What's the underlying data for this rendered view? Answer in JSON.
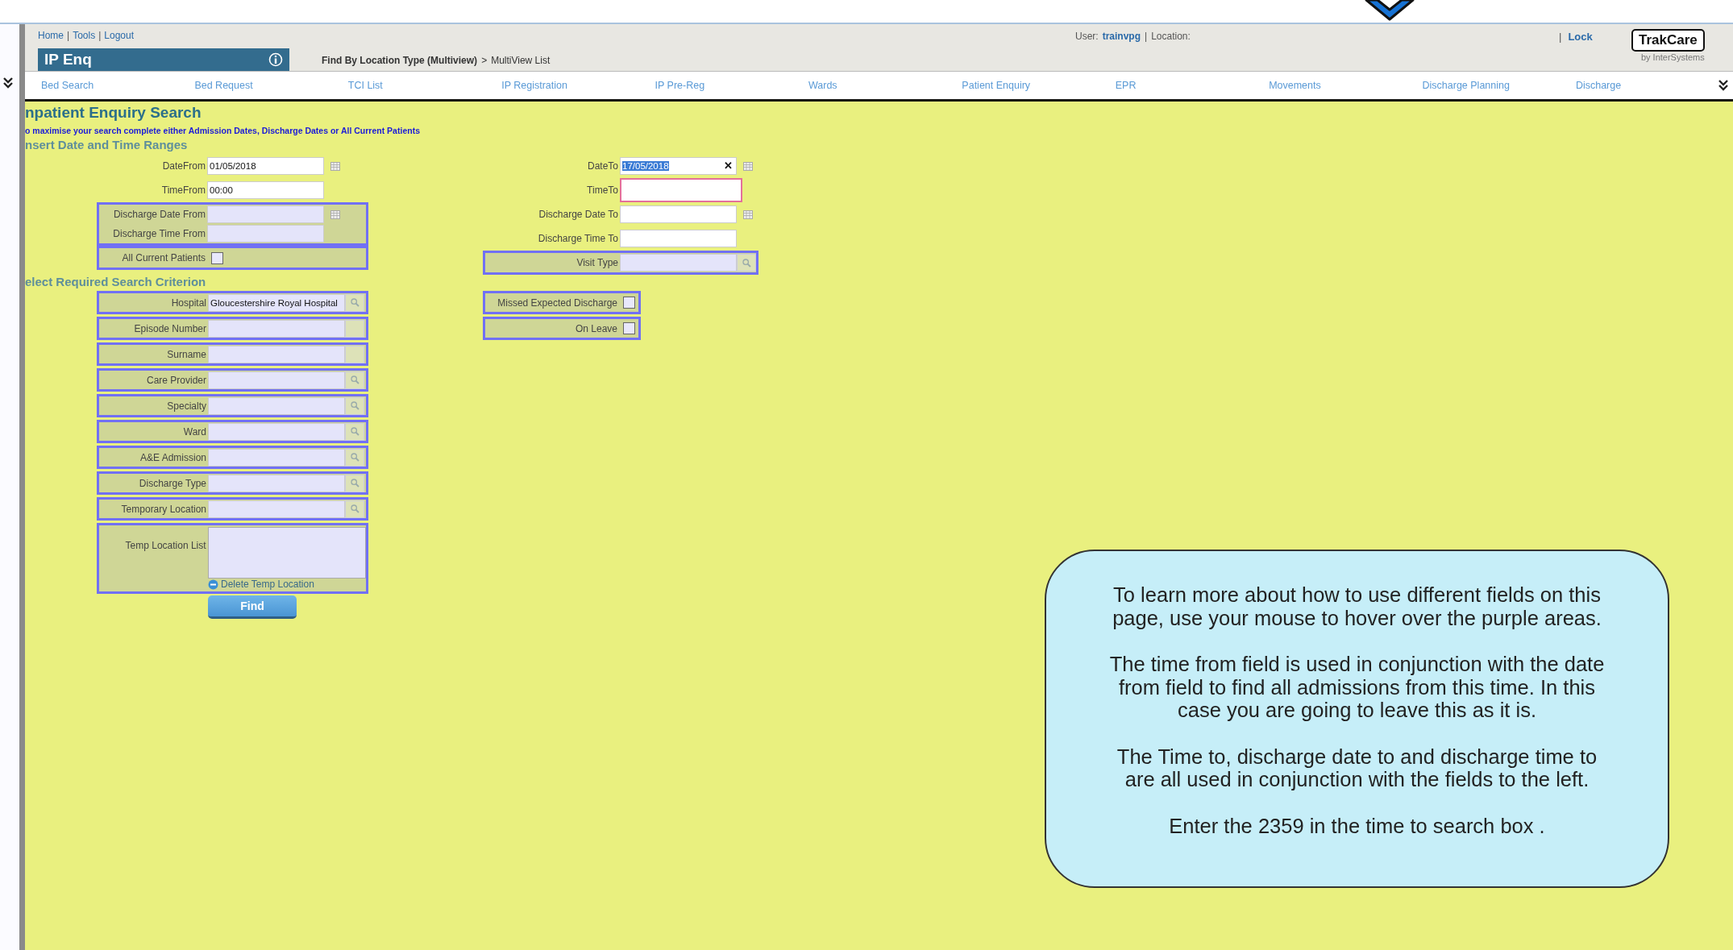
{
  "header": {
    "links": [
      "Home",
      "Tools",
      "Logout"
    ],
    "link_separator": "|",
    "title": "IP Enq",
    "breadcrumb": [
      "Find By Location Type (Multiview)",
      "MultiView List"
    ],
    "breadcrumb_separator": ">",
    "user_label": "User:",
    "user": "trainvpg",
    "info_separator": "|",
    "location_label": "Location:",
    "lock_separator": "|",
    "lock": "Lock",
    "logo": "TrakCare",
    "logo_sub": "by InterSystems"
  },
  "nav": {
    "items": [
      "Bed Search",
      "Bed Request",
      "TCI List",
      "IP Registration",
      "IP Pre-Reg",
      "Wards",
      "Patient Enquiry",
      "EPR",
      "Movements",
      "Discharge Planning",
      "Discharge"
    ]
  },
  "page": {
    "title": "npatient Enquiry Search",
    "hint": "o maximise your search complete either Admission Dates, Discharge Dates or All Current Patients",
    "dates_heading": "nsert Date and Time Ranges",
    "criteria_heading": "elect Required Search Criterion"
  },
  "date_groups": {
    "left": [
      {
        "boxed": false,
        "fields": [
          {
            "kind": "text",
            "label": "DateFrom",
            "value": "01/05/2018",
            "text_selected": false,
            "focused": false,
            "calendar": true
          }
        ]
      },
      {
        "boxed": false,
        "fields": [
          {
            "kind": "text",
            "label": "TimeFrom",
            "value": "00:00",
            "text_selected": false,
            "focused": false,
            "calendar": false
          }
        ]
      },
      {
        "boxed": true,
        "fields": [
          {
            "kind": "text",
            "label": "Discharge Date From",
            "focused": false,
            "calendar": true
          },
          {
            "kind": "text",
            "label": "Discharge Time From",
            "focused": false,
            "calendar": false
          }
        ]
      },
      {
        "boxed": true,
        "fields": [
          {
            "kind": "checkbox",
            "label": "All Current Patients",
            "checked": false
          }
        ]
      }
    ],
    "right": [
      {
        "boxed": false,
        "fields": [
          {
            "kind": "text",
            "label": "DateTo",
            "value": "17/05/2018",
            "text_selected": true,
            "focused": false,
            "clear": "✕",
            "calendar": true
          }
        ]
      },
      {
        "boxed": false,
        "fields": [
          {
            "kind": "text",
            "label": "TimeTo",
            "focused": true,
            "calendar": false
          }
        ]
      },
      {
        "boxed": false,
        "fields": [
          {
            "kind": "text",
            "label": "Discharge Date To",
            "focused": false,
            "calendar": true
          }
        ]
      },
      {
        "boxed": false,
        "fields": [
          {
            "kind": "text",
            "label": "Discharge Time To",
            "focused": false,
            "calendar": false
          }
        ]
      },
      {
        "boxed": true,
        "fields": [
          {
            "kind": "lookup",
            "label": "Visit Type"
          }
        ]
      }
    ]
  },
  "criteria": {
    "left": [
      {
        "kind": "lookup",
        "label": "Hospital",
        "value": "Gloucestershire Royal Hospital"
      },
      {
        "kind": "text",
        "label": "Episode Number"
      },
      {
        "kind": "text",
        "label": "Surname"
      },
      {
        "kind": "lookup",
        "label": "Care Provider"
      },
      {
        "kind": "lookup",
        "label": "Specialty"
      },
      {
        "kind": "lookup",
        "label": "Ward"
      },
      {
        "kind": "lookup",
        "label": "A&E Admission"
      },
      {
        "kind": "lookup",
        "label": "Discharge Type"
      },
      {
        "kind": "lookup",
        "label": "Temporary Location"
      },
      {
        "kind": "list",
        "label": "Temp Location List",
        "action": "Delete Temp Location"
      }
    ],
    "right": [
      {
        "kind": "checkbox",
        "label": "Missed Expected Discharge",
        "checked": false
      },
      {
        "kind": "checkbox",
        "label": "On Leave",
        "checked": false
      }
    ]
  },
  "find_button": "Find",
  "help": {
    "paragraphs": [
      "To learn more about how to use different fields on this page, use your mouse to hover over the purple areas.",
      "The time from field is used in conjunction with the date from field to find all admissions from this time.  In this case you are going to leave this as it is.",
      "The Time to, discharge date to and discharge time to are all used in conjunction with the fields to the left.",
      "Enter the 2359 in the time to search box ."
    ]
  }
}
